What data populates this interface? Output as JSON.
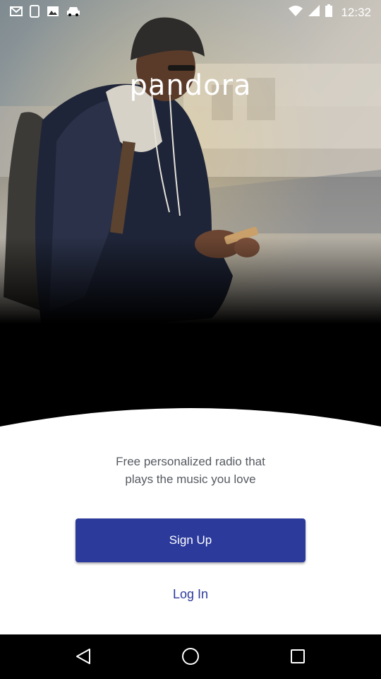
{
  "app": {
    "brand": "pandora"
  },
  "status_bar": {
    "time": "12:32",
    "icons": [
      "mail-icon",
      "tablet-icon",
      "image-icon",
      "car-icon",
      "wifi-icon",
      "signal-icon",
      "battery-icon"
    ]
  },
  "welcome": {
    "tagline_line1": "Free personalized radio that",
    "tagline_line2": "plays the music you love"
  },
  "actions": {
    "signup_label": "Sign Up",
    "login_label": "Log In"
  },
  "nav_bar": {
    "icons": [
      "back-icon",
      "home-icon",
      "recents-icon"
    ]
  },
  "colors": {
    "accent": "#2b3a9b",
    "tagline": "#555a60",
    "background": "#000000",
    "card": "#ffffff"
  }
}
